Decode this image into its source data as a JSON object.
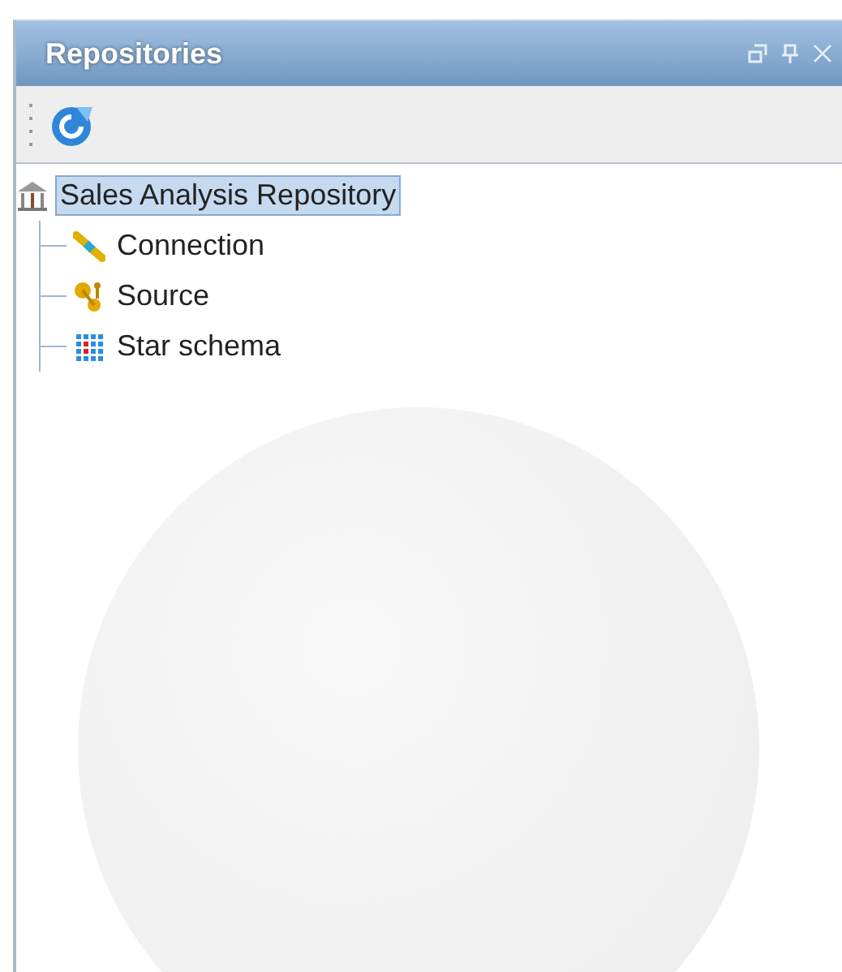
{
  "panel": {
    "title": "Repositories"
  },
  "tree": [
    {
      "label": "Sales Analysis Repository",
      "kind": "repository",
      "selected": true,
      "children": [
        {
          "label": "Connection",
          "kind": "connection",
          "selected": false
        },
        {
          "label": "Source",
          "kind": "source",
          "selected": false
        },
        {
          "label": "Star schema",
          "kind": "schema",
          "selected": false
        }
      ]
    }
  ]
}
